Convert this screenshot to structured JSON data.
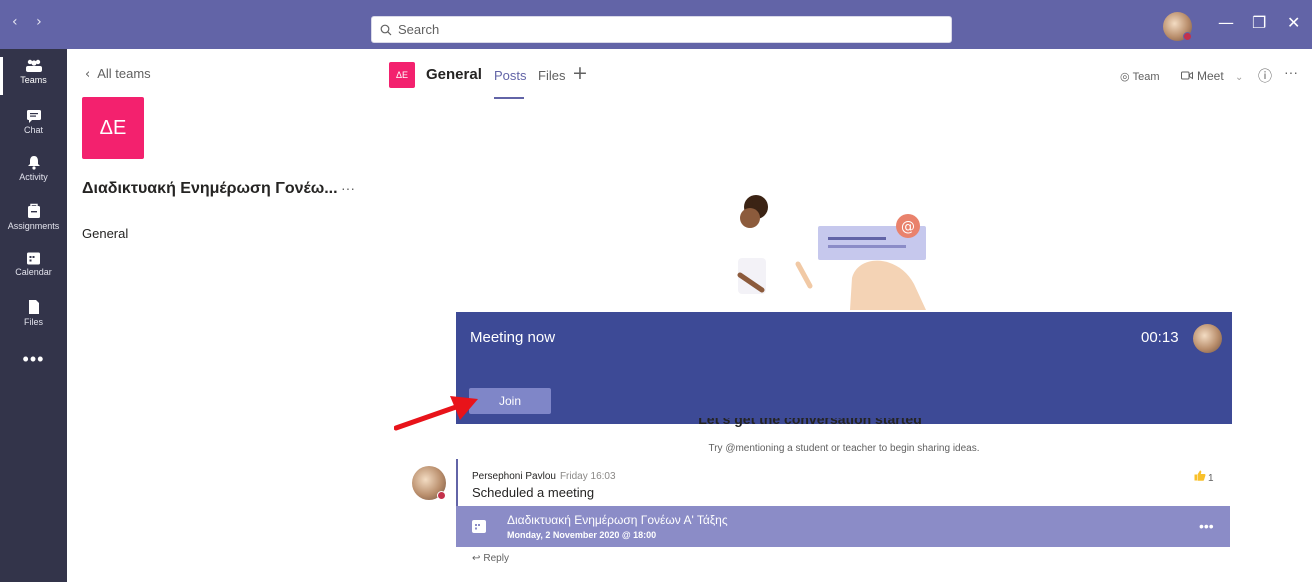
{
  "titlebar": {
    "back": "‹",
    "forward": "›",
    "search_placeholder": "Search",
    "minimize": "—",
    "maximize": "❐",
    "close": "✕"
  },
  "appbar": {
    "items": [
      {
        "label": "Teams",
        "icon": "teams-icon"
      },
      {
        "label": "Chat",
        "icon": "chat-icon"
      },
      {
        "label": "Activity",
        "icon": "bell-icon"
      },
      {
        "label": "Assignments",
        "icon": "assignments-icon"
      },
      {
        "label": "Calendar",
        "icon": "calendar-icon"
      },
      {
        "label": "Files",
        "icon": "file-icon"
      }
    ],
    "more": "•••"
  },
  "leftpanel": {
    "back_label": "All teams",
    "team_initials": "ΔΕ",
    "team_name": "Διαδικτυακή Ενημέρωση Γονέω...",
    "team_more": "···",
    "channel": "General"
  },
  "header": {
    "initials": "ΔΕ",
    "channel_name": "General",
    "tabs": [
      "Posts",
      "Files"
    ],
    "add_tab": "+",
    "team_btn": "Team",
    "meet_btn": "Meet",
    "info": "ⓘ",
    "more": "···"
  },
  "meeting": {
    "title": "Meeting now",
    "timer": "00:13",
    "join_label": "Join"
  },
  "conversation": {
    "heading": "Let's get the conversation started",
    "hint": "Try @mentioning a student or teacher to begin sharing ideas."
  },
  "post": {
    "author": "Persephoni Pavlou",
    "time": "Friday 16:03",
    "text": "Scheduled a meeting",
    "like_count": "1",
    "card_title": "Διαδικτυακή Ενημέρωση Γονέων Α' Τάξης",
    "card_date": "Monday, 2 November 2020 @ 18:00",
    "card_more": "•••",
    "reply": "Reply"
  },
  "colors": {
    "brand": "#6264a7",
    "rail": "#33344a",
    "team_tile": "#f3216e",
    "meeting_banner": "#3d4a96",
    "annotation_arrow": "#e8131a"
  }
}
